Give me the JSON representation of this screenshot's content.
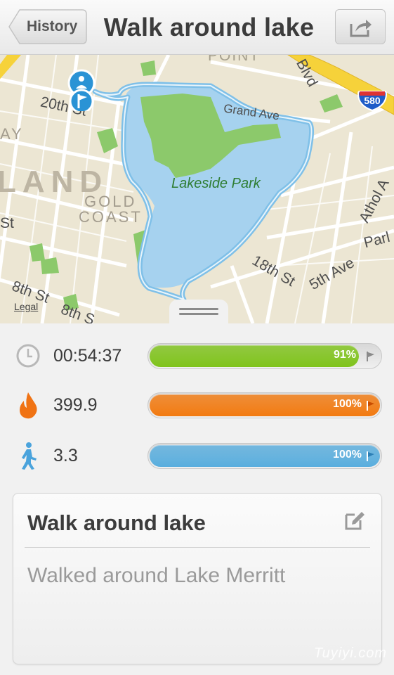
{
  "header": {
    "back_label": "History",
    "title": "Walk around lake",
    "share_icon": "share-icon"
  },
  "map": {
    "park_label": "Lakeside Park",
    "streets": {
      "s20th": "20th St",
      "grand": "Grand Ave",
      "blvd": "Blvd",
      "athol": "Athol A",
      "park": "Parl",
      "s18th": "18th St",
      "ave5": "5th Ave",
      "s8th_a": "8th St",
      "s8th_b": "8th S",
      "st": "St",
      "point": "POINT"
    },
    "district_big": "LAND",
    "district_gold": "GOLD",
    "district_coast": "COAST",
    "district_ay": "AY",
    "freeway": "580",
    "legal": "Legal"
  },
  "stats": [
    {
      "icon": "clock-icon",
      "value": "00:54:37",
      "percent": 91,
      "percent_label": "91%",
      "color": "#7fc31b"
    },
    {
      "icon": "flame-icon",
      "value": "399.9",
      "percent": 100,
      "percent_label": "100%",
      "color": "#f27a10"
    },
    {
      "icon": "walker-icon",
      "value": "3.3",
      "percent": 100,
      "percent_label": "100%",
      "color": "#5aaede"
    }
  ],
  "note": {
    "title": "Walk around lake",
    "text": "Walked around Lake Merritt"
  },
  "watermark": "Tuyiyi.com"
}
